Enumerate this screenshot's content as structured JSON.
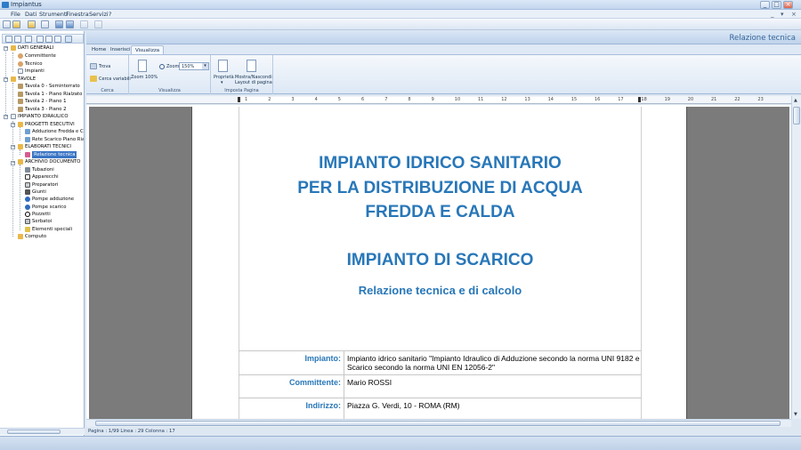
{
  "window": {
    "title": "Impiantus",
    "controls": [
      "_",
      "□",
      "×"
    ]
  },
  "menu": {
    "items": [
      "File",
      "Dati",
      "Strumenti",
      "Finestra",
      "Servizi",
      "?"
    ],
    "right_controls": [
      "_",
      "▾",
      "×"
    ]
  },
  "tree": [
    {
      "label": "DATI GENERALI",
      "icon": "folder-icon"
    },
    {
      "label": "Committente",
      "icon": "user-icon"
    },
    {
      "label": "Tecnico",
      "icon": "user-icon"
    },
    {
      "label": "Impianti",
      "icon": "document-icon"
    },
    {
      "label": "TAVOLE",
      "icon": "folder-icon"
    },
    {
      "label": "Tavola 0 - Seminterrato",
      "icon": "drawing-icon"
    },
    {
      "label": "Tavola 1 - Piano Rialzato",
      "icon": "drawing-icon"
    },
    {
      "label": "Tavola 2 - Piano 1",
      "icon": "drawing-icon"
    },
    {
      "label": "Tavola 3 - Piano 2",
      "icon": "drawing-icon"
    },
    {
      "label": "IMPIANTO IDRAULICO",
      "icon": "document-icon"
    },
    {
      "label": "PROGETTI ESECUTIVI",
      "icon": "folder-icon"
    },
    {
      "label": "Adduzione Fredda e Ca",
      "icon": "pipe-icon"
    },
    {
      "label": "Rete Scarico Piano Rialz",
      "icon": "pipe-icon"
    },
    {
      "label": "ELABORATI TECNICI",
      "icon": "folder-icon"
    },
    {
      "label": "Relazione tecnica",
      "icon": "report-icon",
      "selected": true
    },
    {
      "label": "ARCHIVIO DOCUMENTO",
      "icon": "folder-icon"
    },
    {
      "label": "Tubazioni",
      "icon": "pipe-icon"
    },
    {
      "label": "Apparecchi",
      "icon": "fixture-icon"
    },
    {
      "label": "Preparatori",
      "icon": "heater-icon"
    },
    {
      "label": "Giunti",
      "icon": "joint-icon"
    },
    {
      "label": "Pompe adduzione",
      "icon": "pump-icon"
    },
    {
      "label": "Pompe scarico",
      "icon": "pump-icon"
    },
    {
      "label": "Pozzetti",
      "icon": "manhole-icon"
    },
    {
      "label": "Serbatoi",
      "icon": "tank-icon"
    },
    {
      "label": "Elementi speciali",
      "icon": "special-icon"
    },
    {
      "label": "Computo",
      "icon": "calculator-icon"
    }
  ],
  "header": {
    "title": "Relazione tecnica"
  },
  "ribbon": {
    "tabs": [
      "Home",
      "Inserisci",
      "Visualizza"
    ],
    "active_tab": "Visualizza",
    "groups": {
      "cerca": {
        "label": "Cerca",
        "trova": "Trova",
        "cerca_variabili": "Cerca variabili"
      },
      "visualizza": {
        "label": "Visualizza",
        "zoom100": "Zoom 100%",
        "zoom_label": "Zoom",
        "zoom_value": "150%"
      },
      "imposta": {
        "label": "Imposta Pagina",
        "proprieta": "Proprietà",
        "mostra1": "Mostra/Nascondi",
        "mostra2": "Layout di pagina"
      }
    }
  },
  "ruler": {
    "numbers": [
      "1",
      "2",
      "3",
      "4",
      "5",
      "6",
      "7",
      "8",
      "9",
      "10",
      "11",
      "12",
      "13",
      "14",
      "15",
      "16",
      "17",
      "18",
      "19",
      "20",
      "21",
      "22",
      "23"
    ]
  },
  "document": {
    "title_lines": [
      "IMPIANTO IDRICO SANITARIO",
      "PER LA DISTRIBUZIONE DI ACQUA",
      "FREDDA E CALDA"
    ],
    "subtitle": "IMPIANTO DI SCARICO",
    "subtitle2": "Relazione tecnica e di calcolo",
    "rows": [
      {
        "label": "Impianto:",
        "value": "Impianto idrico sanitario \"Impianto Idraulico di Adduzione secondo la norma UNI 9182 e Scarico secondo la norma UNI EN 12056-2\""
      },
      {
        "label": "Committente:",
        "value": "Mario ROSSI"
      },
      {
        "label": "Indirizzo:",
        "value": "Piazza G. Verdi, 10 - ROMA (RM)"
      }
    ]
  },
  "status": {
    "text": "Pagina : 1/99  Linea : 29  Colonna : 17"
  },
  "colors": {
    "accent": "#2877b8",
    "ribbon": "#dde8f5",
    "page_grey": "#7b7b7b"
  }
}
